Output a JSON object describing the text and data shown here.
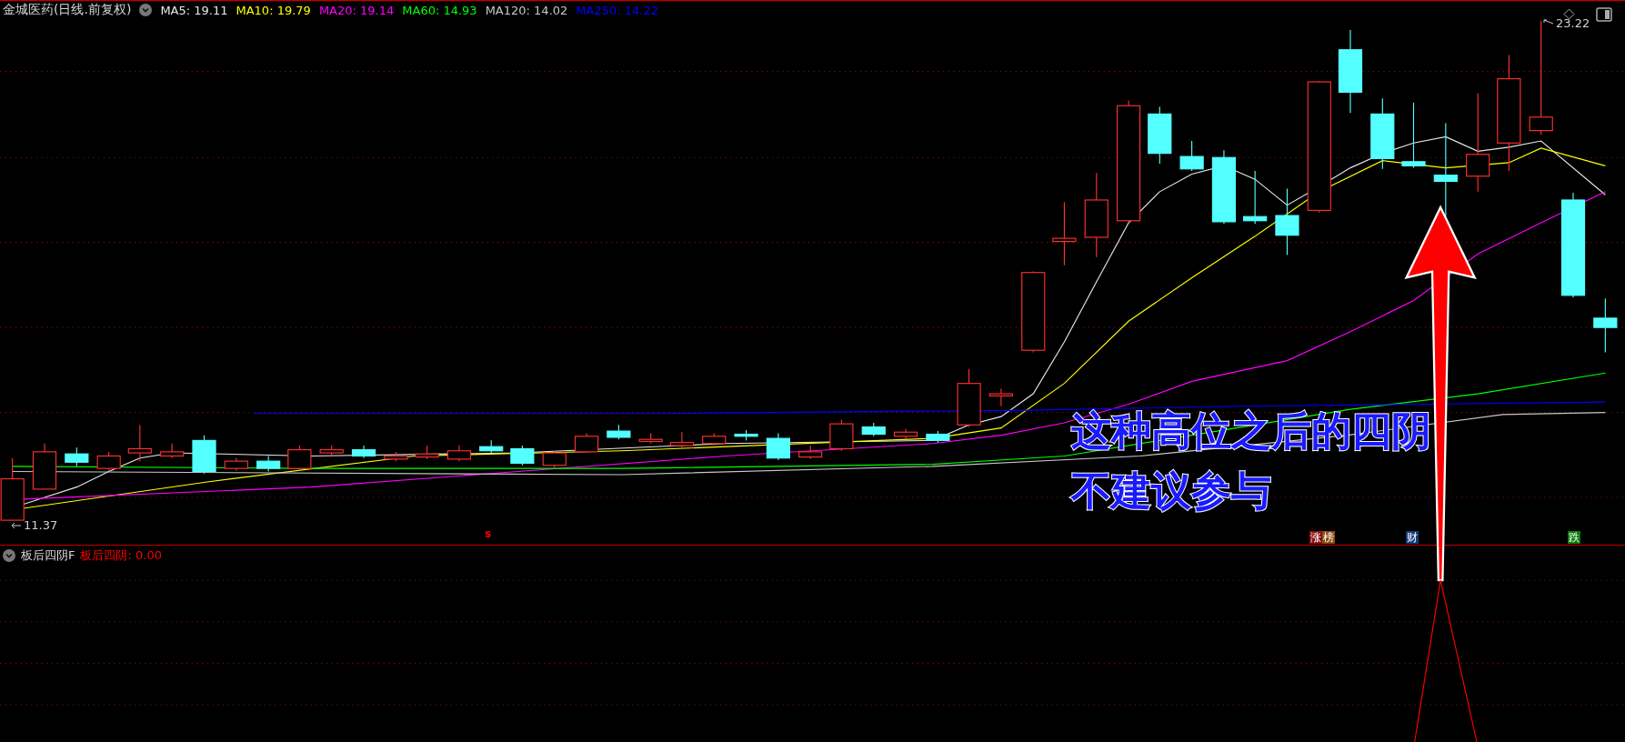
{
  "header": {
    "title": "金城医药(日线.前复权)",
    "ma_readings": [
      {
        "label": "MA5: 19.11",
        "color": "#e8e8e8"
      },
      {
        "label": "MA10: 19.79",
        "color": "#ffff00"
      },
      {
        "label": "MA20: 19.14",
        "color": "#ff00ff"
      },
      {
        "label": "MA60: 14.93",
        "color": "#00ff00"
      },
      {
        "label": "MA120: 14.02",
        "color": "#c8c8c8"
      },
      {
        "label": "MA250: 14.22",
        "color": "#0000ff"
      }
    ]
  },
  "price_labels": {
    "high": "23.22",
    "low": "11.37"
  },
  "markers": [
    {
      "kind": "plain",
      "text": "s",
      "color": "#ff0000"
    },
    {
      "kind": "tag",
      "text": "涨",
      "color": "#8b1010"
    },
    {
      "kind": "tag",
      "text": "榜",
      "color": "#8b4a10"
    },
    {
      "kind": "tag",
      "text": "财",
      "color": "#103a7a"
    },
    {
      "kind": "tag",
      "text": "跌",
      "color": "#0a7a0a"
    }
  ],
  "annotation": {
    "lines": [
      "这种高位之后的四阴",
      "不建议参与"
    ]
  },
  "indicator": {
    "name": "板后四阴F",
    "reading": "板后四阴: 0.00"
  }
}
